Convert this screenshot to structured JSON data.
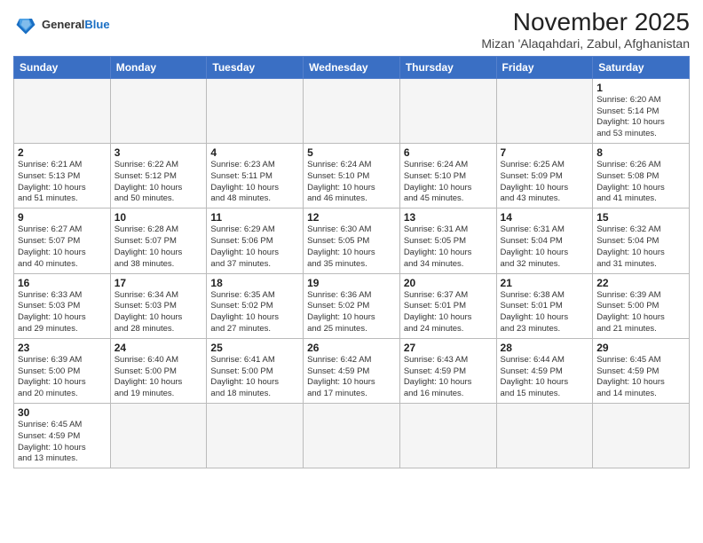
{
  "header": {
    "logo_general": "General",
    "logo_blue": "Blue",
    "month_year": "November 2025",
    "location": "Mizan 'Alaqahdari, Zabul, Afghanistan"
  },
  "days_of_week": [
    "Sunday",
    "Monday",
    "Tuesday",
    "Wednesday",
    "Thursday",
    "Friday",
    "Saturday"
  ],
  "weeks": [
    [
      {
        "day": "",
        "info": ""
      },
      {
        "day": "",
        "info": ""
      },
      {
        "day": "",
        "info": ""
      },
      {
        "day": "",
        "info": ""
      },
      {
        "day": "",
        "info": ""
      },
      {
        "day": "",
        "info": ""
      },
      {
        "day": "1",
        "info": "Sunrise: 6:20 AM\nSunset: 5:14 PM\nDaylight: 10 hours\nand 53 minutes."
      }
    ],
    [
      {
        "day": "2",
        "info": "Sunrise: 6:21 AM\nSunset: 5:13 PM\nDaylight: 10 hours\nand 51 minutes."
      },
      {
        "day": "3",
        "info": "Sunrise: 6:22 AM\nSunset: 5:12 PM\nDaylight: 10 hours\nand 50 minutes."
      },
      {
        "day": "4",
        "info": "Sunrise: 6:23 AM\nSunset: 5:11 PM\nDaylight: 10 hours\nand 48 minutes."
      },
      {
        "day": "5",
        "info": "Sunrise: 6:24 AM\nSunset: 5:10 PM\nDaylight: 10 hours\nand 46 minutes."
      },
      {
        "day": "6",
        "info": "Sunrise: 6:24 AM\nSunset: 5:10 PM\nDaylight: 10 hours\nand 45 minutes."
      },
      {
        "day": "7",
        "info": "Sunrise: 6:25 AM\nSunset: 5:09 PM\nDaylight: 10 hours\nand 43 minutes."
      },
      {
        "day": "8",
        "info": "Sunrise: 6:26 AM\nSunset: 5:08 PM\nDaylight: 10 hours\nand 41 minutes."
      }
    ],
    [
      {
        "day": "9",
        "info": "Sunrise: 6:27 AM\nSunset: 5:07 PM\nDaylight: 10 hours\nand 40 minutes."
      },
      {
        "day": "10",
        "info": "Sunrise: 6:28 AM\nSunset: 5:07 PM\nDaylight: 10 hours\nand 38 minutes."
      },
      {
        "day": "11",
        "info": "Sunrise: 6:29 AM\nSunset: 5:06 PM\nDaylight: 10 hours\nand 37 minutes."
      },
      {
        "day": "12",
        "info": "Sunrise: 6:30 AM\nSunset: 5:05 PM\nDaylight: 10 hours\nand 35 minutes."
      },
      {
        "day": "13",
        "info": "Sunrise: 6:31 AM\nSunset: 5:05 PM\nDaylight: 10 hours\nand 34 minutes."
      },
      {
        "day": "14",
        "info": "Sunrise: 6:31 AM\nSunset: 5:04 PM\nDaylight: 10 hours\nand 32 minutes."
      },
      {
        "day": "15",
        "info": "Sunrise: 6:32 AM\nSunset: 5:04 PM\nDaylight: 10 hours\nand 31 minutes."
      }
    ],
    [
      {
        "day": "16",
        "info": "Sunrise: 6:33 AM\nSunset: 5:03 PM\nDaylight: 10 hours\nand 29 minutes."
      },
      {
        "day": "17",
        "info": "Sunrise: 6:34 AM\nSunset: 5:03 PM\nDaylight: 10 hours\nand 28 minutes."
      },
      {
        "day": "18",
        "info": "Sunrise: 6:35 AM\nSunset: 5:02 PM\nDaylight: 10 hours\nand 27 minutes."
      },
      {
        "day": "19",
        "info": "Sunrise: 6:36 AM\nSunset: 5:02 PM\nDaylight: 10 hours\nand 25 minutes."
      },
      {
        "day": "20",
        "info": "Sunrise: 6:37 AM\nSunset: 5:01 PM\nDaylight: 10 hours\nand 24 minutes."
      },
      {
        "day": "21",
        "info": "Sunrise: 6:38 AM\nSunset: 5:01 PM\nDaylight: 10 hours\nand 23 minutes."
      },
      {
        "day": "22",
        "info": "Sunrise: 6:39 AM\nSunset: 5:00 PM\nDaylight: 10 hours\nand 21 minutes."
      }
    ],
    [
      {
        "day": "23",
        "info": "Sunrise: 6:39 AM\nSunset: 5:00 PM\nDaylight: 10 hours\nand 20 minutes."
      },
      {
        "day": "24",
        "info": "Sunrise: 6:40 AM\nSunset: 5:00 PM\nDaylight: 10 hours\nand 19 minutes."
      },
      {
        "day": "25",
        "info": "Sunrise: 6:41 AM\nSunset: 5:00 PM\nDaylight: 10 hours\nand 18 minutes."
      },
      {
        "day": "26",
        "info": "Sunrise: 6:42 AM\nSunset: 4:59 PM\nDaylight: 10 hours\nand 17 minutes."
      },
      {
        "day": "27",
        "info": "Sunrise: 6:43 AM\nSunset: 4:59 PM\nDaylight: 10 hours\nand 16 minutes."
      },
      {
        "day": "28",
        "info": "Sunrise: 6:44 AM\nSunset: 4:59 PM\nDaylight: 10 hours\nand 15 minutes."
      },
      {
        "day": "29",
        "info": "Sunrise: 6:45 AM\nSunset: 4:59 PM\nDaylight: 10 hours\nand 14 minutes."
      }
    ],
    [
      {
        "day": "30",
        "info": "Sunrise: 6:45 AM\nSunset: 4:59 PM\nDaylight: 10 hours\nand 13 minutes."
      },
      {
        "day": "",
        "info": ""
      },
      {
        "day": "",
        "info": ""
      },
      {
        "day": "",
        "info": ""
      },
      {
        "day": "",
        "info": ""
      },
      {
        "day": "",
        "info": ""
      },
      {
        "day": "",
        "info": ""
      }
    ]
  ]
}
